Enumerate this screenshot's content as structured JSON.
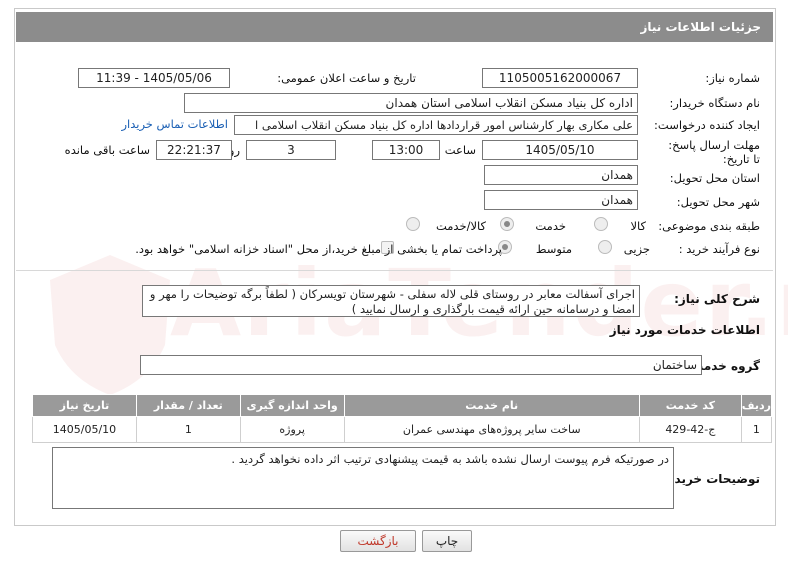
{
  "header": {
    "title": "جزئیات اطلاعات نیاز"
  },
  "need_number": {
    "label": "شماره نیاز:",
    "value": "1105005162000067"
  },
  "announce": {
    "label": "تاریخ و ساعت اعلان عمومی:",
    "value": "1405/05/06 - 11:39"
  },
  "buyer_org": {
    "label": "نام دستگاه خریدار:",
    "value": "اداره کل بنیاد مسکن انقلاب اسلامی استان همدان"
  },
  "requester": {
    "label": "ایجاد کننده درخواست:",
    "value": "علی مکاری بهار کارشناس امور قراردادها اداره کل بنیاد مسکن انقلاب اسلامی ا",
    "contact_link": "اطلاعات تماس خریدار"
  },
  "deadline": {
    "label": "مهلت ارسال پاسخ: تا تاریخ:",
    "date": "1405/05/10",
    "time_label": "ساعت",
    "time": "13:00",
    "days": "3",
    "days_label": "روز و",
    "remaining": "22:21:37",
    "remaining_label": "ساعت باقی مانده"
  },
  "province": {
    "label": "استان محل تحویل:",
    "value": "همدان"
  },
  "city": {
    "label": "شهر محل تحویل:",
    "value": "همدان"
  },
  "category": {
    "label": "طبقه بندی موضوعی:",
    "options": [
      "کالا",
      "خدمت",
      "کالا/خدمت"
    ],
    "selected": "خدمت"
  },
  "purchase_type": {
    "label": "نوع فرآیند خرید :",
    "options": [
      "جزیی",
      "متوسط"
    ],
    "selected": "متوسط",
    "payment_note": "پرداخت تمام یا بخشی از مبلغ خرید،از محل \"اسناد خزانه اسلامی\" خواهد بود."
  },
  "summary": {
    "label": "شرح کلی نیاز:",
    "value": "اجرای آسفالت معابر در روستای قلی لاله سفلی - شهرستان تویسرکان ( لطفاً برگه توضیحات را مهر و امضا و درسامانه حین ارائه قیمت بارگذاری و ارسال نمایید )"
  },
  "services_title": "اطلاعات خدمات مورد نیاز",
  "service_group": {
    "label": "گروه خدمت:",
    "value": "ساختمان"
  },
  "table": {
    "headers": [
      "ردیف",
      "کد خدمت",
      "نام خدمت",
      "واحد اندازه گیری",
      "تعداد / مقدار",
      "تاریخ نیاز"
    ],
    "rows": [
      [
        "1",
        "ج-42-429",
        "ساخت سایر پروژه‌های مهندسی عمران",
        "پروژه",
        "1",
        "1405/05/10"
      ]
    ]
  },
  "buyer_notes": {
    "label": "توضیحات خریدار:",
    "value": "در صورتیکه فرم پیوست ارسال نشده باشد به قیمت پیشنهادی ترتیب اثر داده نخواهد گردید ."
  },
  "buttons": {
    "print": "چاپ",
    "back": "بازگشت"
  },
  "watermark": "AriaTender.neT"
}
